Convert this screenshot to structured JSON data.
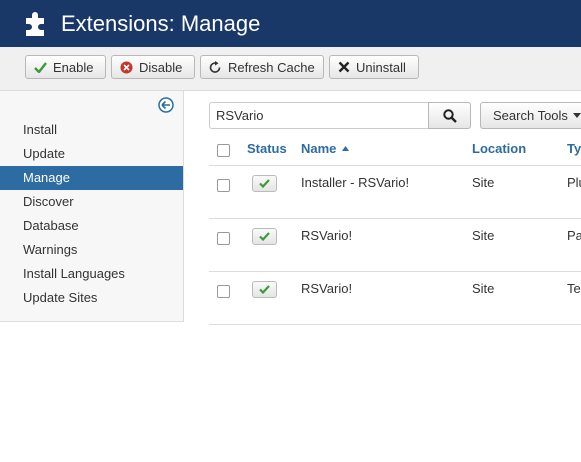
{
  "header": {
    "title": "Extensions: Manage",
    "icon": "puzzle-icon"
  },
  "toolbar": {
    "enable_label": "Enable",
    "disable_label": "Disable",
    "refresh_label": "Refresh Cache",
    "uninstall_label": "Uninstall"
  },
  "sidebar": {
    "items": [
      {
        "label": "Install"
      },
      {
        "label": "Update"
      },
      {
        "label": "Manage",
        "active": true
      },
      {
        "label": "Discover"
      },
      {
        "label": "Database"
      },
      {
        "label": "Warnings"
      },
      {
        "label": "Install Languages"
      },
      {
        "label": "Update Sites"
      }
    ]
  },
  "search": {
    "value": "RSVario",
    "tools_label": "Search Tools"
  },
  "table": {
    "headers": {
      "status": "Status",
      "name": "Name",
      "location": "Location",
      "type": "Ty"
    },
    "rows": [
      {
        "name": "Installer - RSVario!",
        "location": "Site",
        "type": "Plu"
      },
      {
        "name": "RSVario!",
        "location": "Site",
        "type": "Pa"
      },
      {
        "name": "RSVario!",
        "location": "Site",
        "type": "Te"
      }
    ]
  },
  "colors": {
    "header_bg": "#1a3867",
    "accent": "#2d6ca2",
    "enabled_check": "#3c9a3c",
    "disable_icon": "#c0392b"
  }
}
